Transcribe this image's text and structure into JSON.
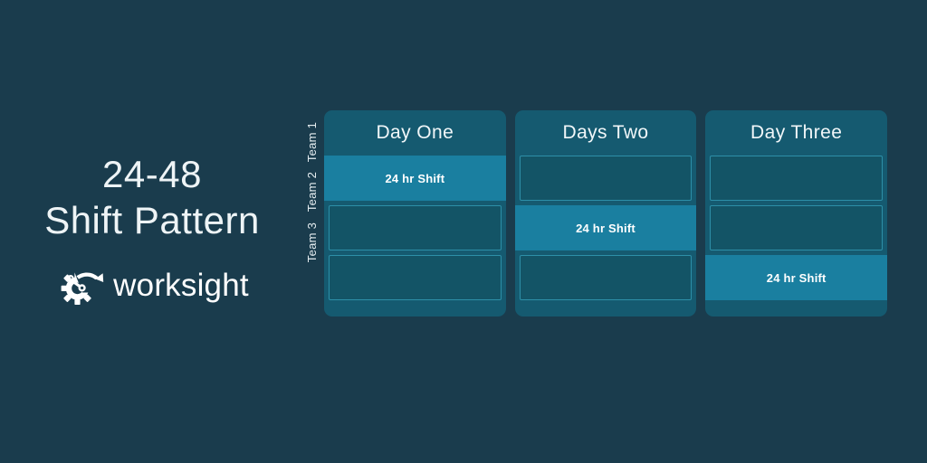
{
  "brand": {
    "title_line_1": "24-48",
    "title_line_2": "Shift Pattern",
    "logo_icon": "gear-wrench-arrow-icon",
    "logo_word": "worksight"
  },
  "colors": {
    "background": "#1a3c4d",
    "card": "#155a70",
    "cell_idle": "#135466",
    "cell_idle_border": "#2d8fa8",
    "cell_active": "#1a7fa0",
    "text": "#ffffff"
  },
  "schedule": {
    "row_labels": [
      "Team 1",
      "Team 2",
      "Team 3"
    ],
    "columns": [
      {
        "header": "Day One",
        "cells": [
          {
            "label": "24 hr Shift",
            "state": "active"
          },
          {
            "label": "",
            "state": "idle"
          },
          {
            "label": "",
            "state": "idle"
          }
        ]
      },
      {
        "header": "Days Two",
        "cells": [
          {
            "label": "",
            "state": "idle"
          },
          {
            "label": "24 hr Shift",
            "state": "active"
          },
          {
            "label": "",
            "state": "idle"
          }
        ]
      },
      {
        "header": "Day Three",
        "cells": [
          {
            "label": "",
            "state": "idle"
          },
          {
            "label": "",
            "state": "idle"
          },
          {
            "label": "24 hr Shift",
            "state": "active"
          }
        ]
      }
    ]
  }
}
